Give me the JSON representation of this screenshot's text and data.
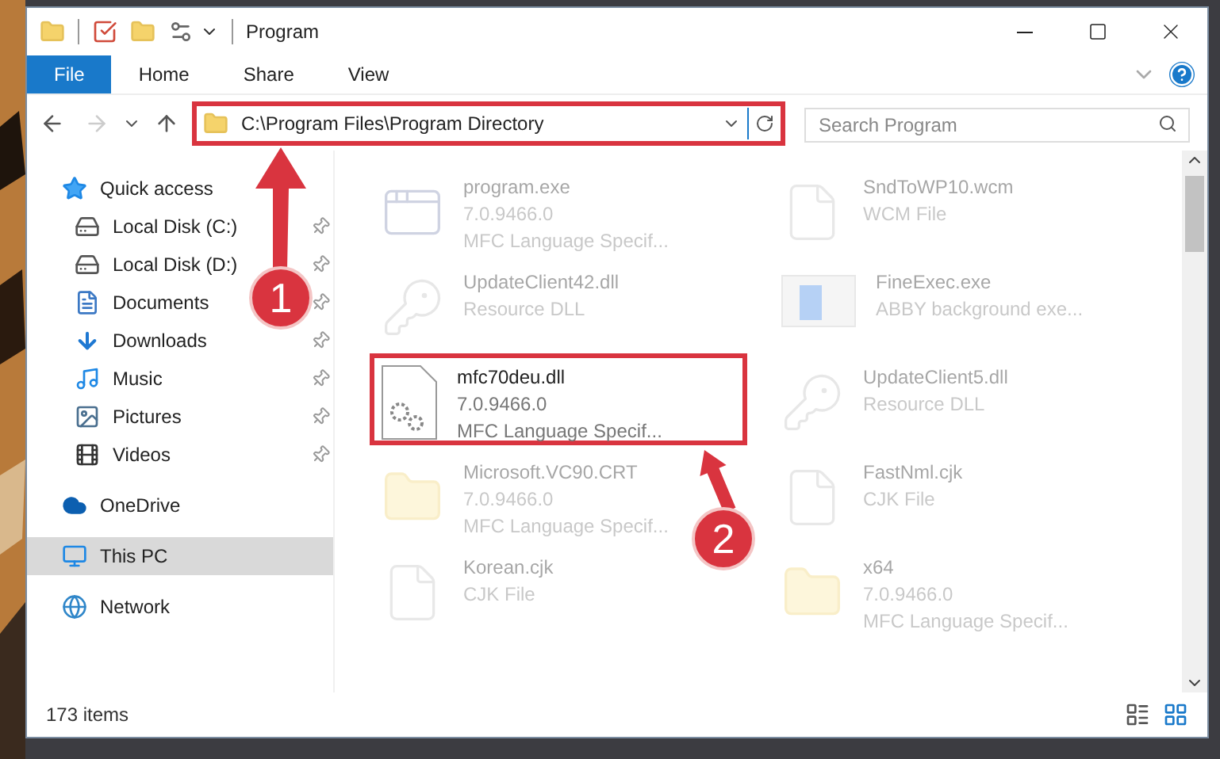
{
  "window": {
    "title": "Program"
  },
  "ribbon": {
    "tabs": [
      {
        "label": "File",
        "selected": true
      },
      {
        "label": "Home",
        "selected": false
      },
      {
        "label": "Share",
        "selected": false
      },
      {
        "label": "View",
        "selected": false
      }
    ]
  },
  "address_bar": {
    "path": "C:\\Program Files\\Program Directory",
    "highlighted": true
  },
  "search": {
    "placeholder": "Search Program"
  },
  "sidebar": {
    "items": [
      {
        "label": "Quick access",
        "kind": "star",
        "selected": false,
        "children": [
          {
            "label": "Local Disk (C:)",
            "kind": "disk",
            "pinned": true,
            "selected": false
          },
          {
            "label": "Local Disk (D:)",
            "kind": "disk",
            "pinned": true,
            "selected": false
          },
          {
            "label": "Documents",
            "kind": "documents",
            "pinned": true,
            "selected": false
          },
          {
            "label": "Downloads",
            "kind": "downloads",
            "pinned": true,
            "selected": false
          },
          {
            "label": "Music",
            "kind": "music",
            "pinned": true,
            "selected": false
          },
          {
            "label": "Pictures",
            "kind": "pictures",
            "pinned": true,
            "selected": false
          },
          {
            "label": "Videos",
            "kind": "videos",
            "pinned": true,
            "selected": false
          }
        ]
      },
      {
        "label": "OneDrive",
        "kind": "cloud",
        "selected": false
      },
      {
        "label": "This PC",
        "kind": "pc",
        "selected": true
      },
      {
        "label": "Network",
        "kind": "network",
        "selected": false
      }
    ]
  },
  "files": [
    {
      "name": "program.exe",
      "details": [
        "7.0.9466.0",
        "MFC Language Specif..."
      ],
      "kind": "app",
      "blurred": true,
      "highlighted": false
    },
    {
      "name": "SndToWP10.wcm",
      "details": [
        "WCM File"
      ],
      "kind": "blank",
      "blurred": true,
      "highlighted": false
    },
    {
      "name": "UpdateClient42.dll",
      "details": [
        "Resource DLL"
      ],
      "kind": "dll",
      "blurred": true,
      "highlighted": false
    },
    {
      "name": "FineExec.exe",
      "details": [
        "ABBY background exe..."
      ],
      "kind": "window",
      "blurred": true,
      "highlighted": false
    },
    {
      "name": "mfc70deu.dll",
      "details": [
        "7.0.9466.0",
        "MFC Language Specif..."
      ],
      "kind": "gears",
      "blurred": false,
      "highlighted": true
    },
    {
      "name": "UpdateClient5.dll",
      "details": [
        "Resource DLL"
      ],
      "kind": "dll",
      "blurred": true,
      "highlighted": false
    },
    {
      "name": "Microsoft.VC90.CRT",
      "details": [
        "7.0.9466.0",
        "MFC Language Specif..."
      ],
      "kind": "folder",
      "blurred": true,
      "highlighted": false
    },
    {
      "name": "FastNml.cjk",
      "details": [
        "CJK File"
      ],
      "kind": "blank",
      "blurred": true,
      "highlighted": false
    },
    {
      "name": "Korean.cjk",
      "details": [
        "CJK File"
      ],
      "kind": "blank",
      "blurred": true,
      "highlighted": false
    },
    {
      "name": "x64",
      "details": [
        "7.0.9466.0",
        "MFC Language Specif..."
      ],
      "kind": "folder",
      "blurred": true,
      "highlighted": false
    }
  ],
  "status_bar": {
    "item_count": "173 items"
  },
  "callouts": [
    {
      "number": "1"
    },
    {
      "number": "2"
    }
  ]
}
